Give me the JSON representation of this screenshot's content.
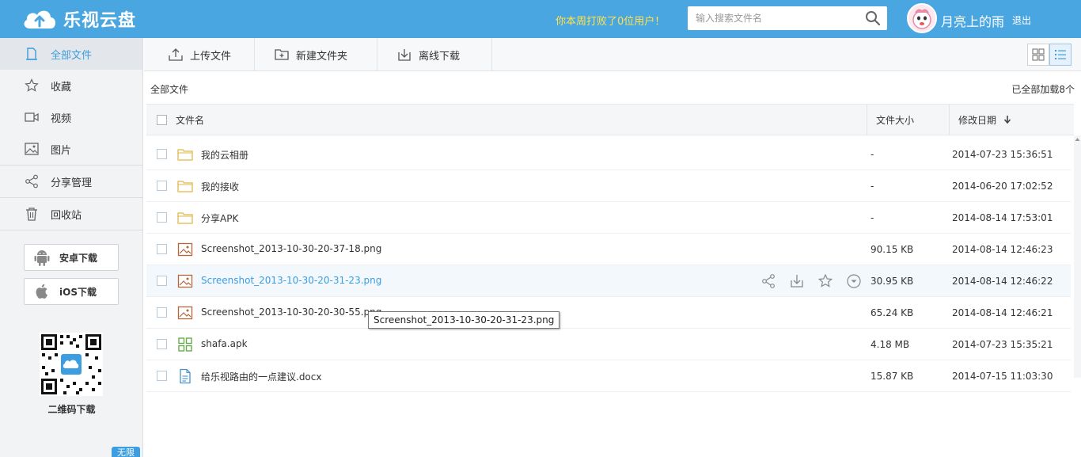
{
  "header": {
    "logo_text": "乐视云盘",
    "promo": "你本周打败了0位用户！",
    "search_placeholder": "输入搜索文件名",
    "username": "月亮上的雨",
    "logout": "退出"
  },
  "sidebar": {
    "items": [
      {
        "label": "全部文件",
        "icon": "files-icon"
      },
      {
        "label": "收藏",
        "icon": "star-icon"
      },
      {
        "label": "视频",
        "icon": "video-icon"
      },
      {
        "label": "图片",
        "icon": "image-icon"
      },
      {
        "label": "分享管理",
        "icon": "share-icon"
      },
      {
        "label": "回收站",
        "icon": "trash-icon"
      }
    ],
    "android_download": "安卓下载",
    "ios_download": "iOS下载",
    "qr_label": "二维码下载",
    "badge": "无限"
  },
  "toolbar": {
    "upload": "上传文件",
    "new_folder": "新建文件夹",
    "offline_download": "离线下载"
  },
  "breadcrumb": "全部文件",
  "loaded_count": "已全部加载8个",
  "table": {
    "col_name": "文件名",
    "col_size": "文件大小",
    "col_date": "修改日期",
    "rows": [
      {
        "name": "我的云相册",
        "type": "folder",
        "size": "-",
        "date": "2014-07-23 15:36:51"
      },
      {
        "name": "我的接收",
        "type": "folder",
        "size": "-",
        "date": "2014-06-20 17:02:52"
      },
      {
        "name": "分享APK",
        "type": "folder",
        "size": "-",
        "date": "2014-08-14 17:53:01"
      },
      {
        "name": "Screenshot_2013-10-30-20-37-18.png",
        "type": "image",
        "size": "90.15 KB",
        "date": "2014-08-14 12:46:23"
      },
      {
        "name": "Screenshot_2013-10-30-20-31-23.png",
        "type": "image",
        "size": "30.95 KB",
        "date": "2014-08-14 12:46:22"
      },
      {
        "name": "Screenshot_2013-10-30-20-30-55.png",
        "type": "image",
        "size": "65.24 KB",
        "date": "2014-08-14 12:46:21"
      },
      {
        "name": "shafa.apk",
        "type": "apk",
        "size": "4.18 MB",
        "date": "2014-07-23 15:35:21"
      },
      {
        "name": "给乐视路由的一点建议.docx",
        "type": "doc",
        "size": "15.87 KB",
        "date": "2014-07-15 11:03:30"
      }
    ]
  },
  "tooltip": "Screenshot_2013-10-30-20-31-23.png"
}
